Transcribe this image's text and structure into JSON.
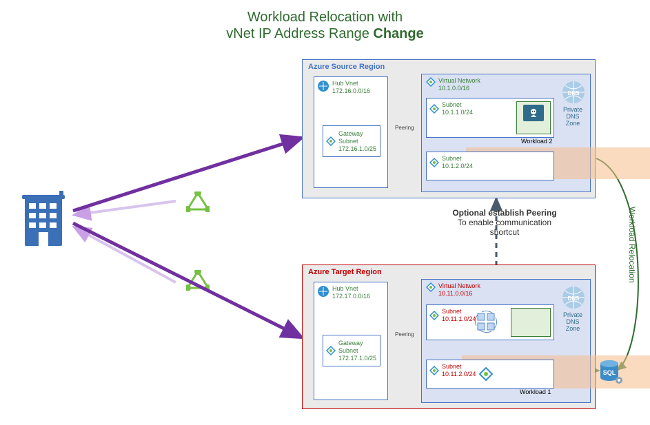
{
  "title": {
    "line1": "Workload Relocation with",
    "line2_prefix": "vNet IP Address Range ",
    "line2_bold": "Change"
  },
  "source": {
    "region_title": "Azure Source Region",
    "hub": {
      "name": "Hub Vnet",
      "cidr": "172.16.0.0/16"
    },
    "gateway": {
      "name": "Gateway Subnet",
      "cidr": "172.16.1.0/25"
    },
    "peering": "Peering",
    "vnet": {
      "name": "Virtual Network",
      "cidr": "10.1.0.0/16"
    },
    "subnet1": {
      "name": "Subnet",
      "cidr": "10.1.1.0/24"
    },
    "subnet2": {
      "name": "Subnet",
      "cidr": "10.1.2.0/24"
    },
    "dns": "Private DNS Zone",
    "workload2": "Workload 2"
  },
  "target": {
    "region_title": "Azure Target Region",
    "hub": {
      "name": "Hub Vnet",
      "cidr": "172.17.0.0/16"
    },
    "gateway": {
      "name": "Gateway Subnet",
      "cidr": "172.17.1.0/25"
    },
    "peering": "Peering",
    "vnet": {
      "name": "Virtual Network",
      "cidr": "10.11.0.0/16"
    },
    "subnet1": {
      "name": "Subnet",
      "cidr": "10.11.1.0/24"
    },
    "subnet2": {
      "name": "Subnet",
      "cidr": "10.11.2.0/24"
    },
    "dns": "Private DNS Zone",
    "workload1": "Workload 1"
  },
  "mid": {
    "bold": "Optional establish Peering",
    "rest1": "To enable communication",
    "rest2": "shortcut"
  },
  "side": "Workload Relocation"
}
